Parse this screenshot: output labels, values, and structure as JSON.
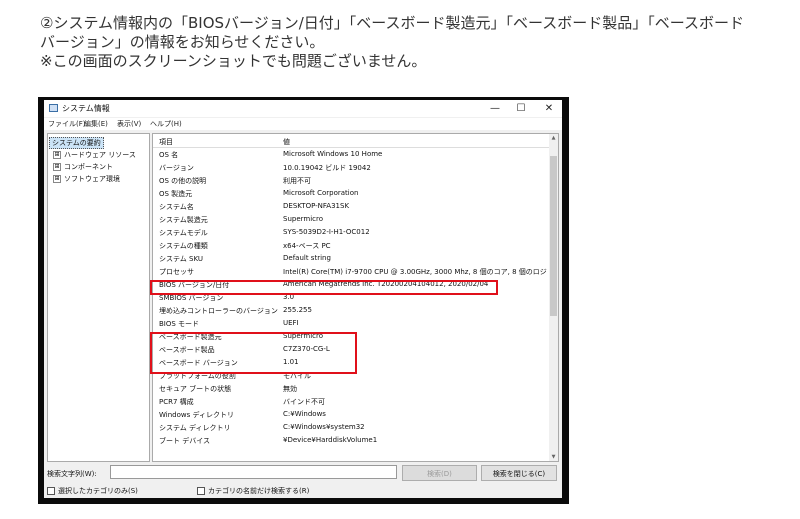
{
  "intro": {
    "line1": "②システム情報内の「BIOSバージョン/日付」「ベースボード製造元」「ベースボード製品」「ベースボード",
    "line2": "バージョン」の情報をお知らせください。",
    "line3": "※この画面のスクリーンショットでも問題ございません。"
  },
  "window": {
    "title": "システム情報",
    "controls": [
      "—",
      "☐",
      "✕"
    ],
    "menu": [
      "ファイル(F)",
      "編集(E)",
      "表示(V)",
      "ヘルプ(H)"
    ]
  },
  "tree": {
    "root": "システムの要約",
    "children": [
      "ハードウェア リソース",
      "コンポーネント",
      "ソフトウェア環境"
    ],
    "expander": "⊞"
  },
  "table": {
    "headers": [
      "項目",
      "値"
    ],
    "rows": [
      [
        "OS 名",
        "Microsoft Windows 10 Home"
      ],
      [
        "バージョン",
        "10.0.19042 ビルド 19042"
      ],
      [
        "OS の他の説明",
        "利用不可"
      ],
      [
        "OS 製造元",
        "Microsoft Corporation"
      ],
      [
        "システム名",
        "DESKTOP-NFA31SK"
      ],
      [
        "システム製造元",
        "Supermicro"
      ],
      [
        "システムモデル",
        "SYS-5039D2-I-H1-OC012"
      ],
      [
        "システムの種類",
        "x64-ベース PC"
      ],
      [
        "システム SKU",
        "Default string"
      ],
      [
        "プロセッサ",
        "Intel(R) Core(TM) i7-9700 CPU @ 3.00GHz, 3000 Mhz, 8 個のコア, 8 個のロジ"
      ],
      [
        "BIOS バージョン/日付",
        "American Megatrends Inc. T20200204104012, 2020/02/04"
      ],
      [
        "SMBIOS バージョン",
        "3.0"
      ],
      [
        "埋め込みコントローラーのバージョン",
        "255.255"
      ],
      [
        "BIOS モード",
        "UEFI"
      ],
      [
        "ベースボード製造元",
        "Supermicro"
      ],
      [
        "ベースボード製品",
        "C7Z370-CG-L"
      ],
      [
        "ベースボード バージョン",
        "1.01"
      ],
      [
        "プラットフォームの役割",
        "モバイル"
      ],
      [
        "セキュア ブートの状態",
        "無効"
      ],
      [
        "PCR7 構成",
        "バインド不可"
      ],
      [
        "Windows ディレクトリ",
        "C:¥Windows"
      ],
      [
        "システム ディレクトリ",
        "C:¥Windows¥system32"
      ],
      [
        "ブート デバイス",
        "¥Device¥HarddiskVolume1"
      ]
    ]
  },
  "find": {
    "label": "検索文字列(W):",
    "value": "",
    "search_button": "検索(D)",
    "close_button": "検索を閉じる(C)",
    "check1": "選択したカテゴリのみ(S)",
    "check2": "カテゴリの名前だけ検索する(R)"
  },
  "highlight_color": "#e0101a"
}
